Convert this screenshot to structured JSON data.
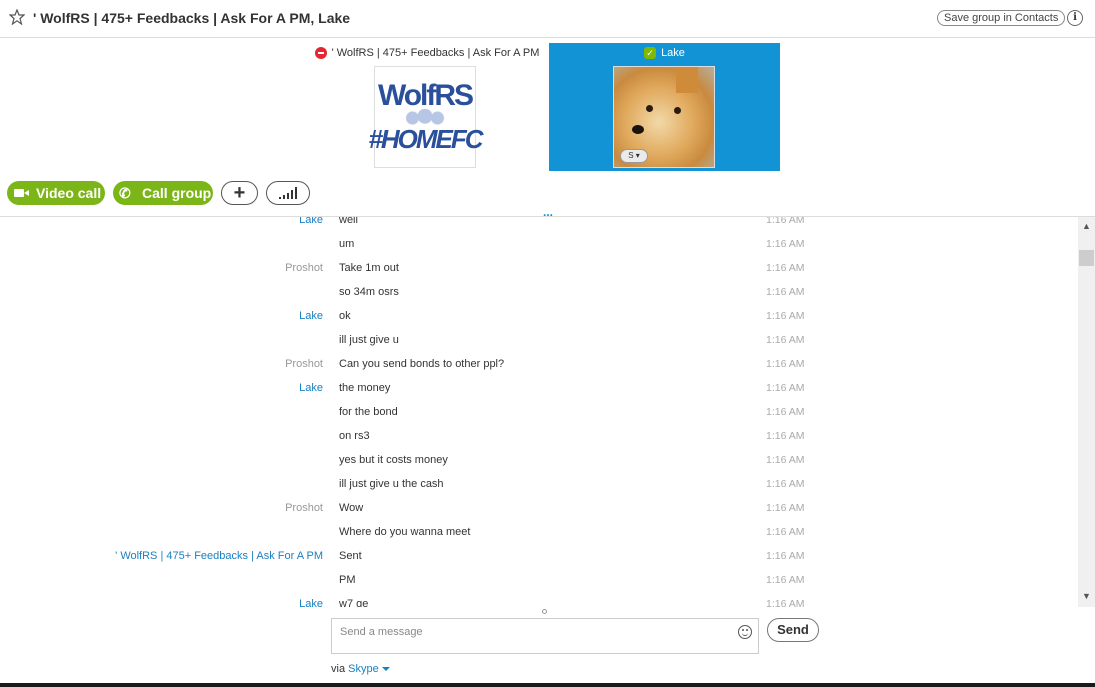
{
  "header": {
    "title": "' WolfRS | 475+ Feedbacks | Ask For A PM, Lake",
    "save_label": "Save group in Contacts",
    "info_label": "i"
  },
  "participants": [
    {
      "name": "' WolfRS | 475+ Feedbacks | Ask For A PM",
      "status": "do-not-disturb",
      "avatar_text": [
        "WolfRS",
        "#HOMEFC"
      ]
    },
    {
      "name": "Lake",
      "status": "online"
    }
  ],
  "actions": {
    "video_label": "Video call",
    "call_label": "Call group",
    "more": "..."
  },
  "messages": [
    {
      "sender": "Lake",
      "text": "well",
      "time": "1:16 AM"
    },
    {
      "sender": "",
      "text": "um",
      "time": "1:16 AM"
    },
    {
      "sender": "Proshot",
      "text": "Take 1m out",
      "time": "1:16 AM"
    },
    {
      "sender": "",
      "text": "so 34m osrs",
      "time": "1:16 AM"
    },
    {
      "sender": "Lake",
      "text": "ok",
      "time": "1:16 AM"
    },
    {
      "sender": "",
      "text": "ill just give u",
      "time": "1:16 AM"
    },
    {
      "sender": "Proshot",
      "text": "Can you send bonds to other ppl?",
      "time": "1:16 AM"
    },
    {
      "sender": "Lake",
      "text": "the money",
      "time": "1:16 AM"
    },
    {
      "sender": "",
      "text": "for the bond",
      "time": "1:16 AM"
    },
    {
      "sender": "",
      "text": "on rs3",
      "time": "1:16 AM"
    },
    {
      "sender": "",
      "text": "yes but it costs money",
      "time": "1:16 AM"
    },
    {
      "sender": "",
      "text": "ill just give u the cash",
      "time": "1:16 AM"
    },
    {
      "sender": "Proshot",
      "text": "Wow",
      "time": "1:16 AM"
    },
    {
      "sender": "",
      "text": "Where do you wanna meet",
      "time": "1:16 AM"
    },
    {
      "sender": "' WolfRS | 475+ Feedbacks | Ask For A PM",
      "text": "Sent",
      "time": "1:16 AM"
    },
    {
      "sender": "",
      "text": "PM",
      "time": "1:16 AM"
    },
    {
      "sender": "Lake",
      "text": "w7 ge",
      "time": "1:16 AM"
    }
  ],
  "compose": {
    "placeholder": "Send a message",
    "send_label": "Send",
    "via_label": "via",
    "via_service": "Skype"
  },
  "colors": {
    "accent_blue": "#1193d5",
    "link_blue": "#1a7fc0",
    "call_green": "#7cb518",
    "dnd_red": "#e42833"
  }
}
